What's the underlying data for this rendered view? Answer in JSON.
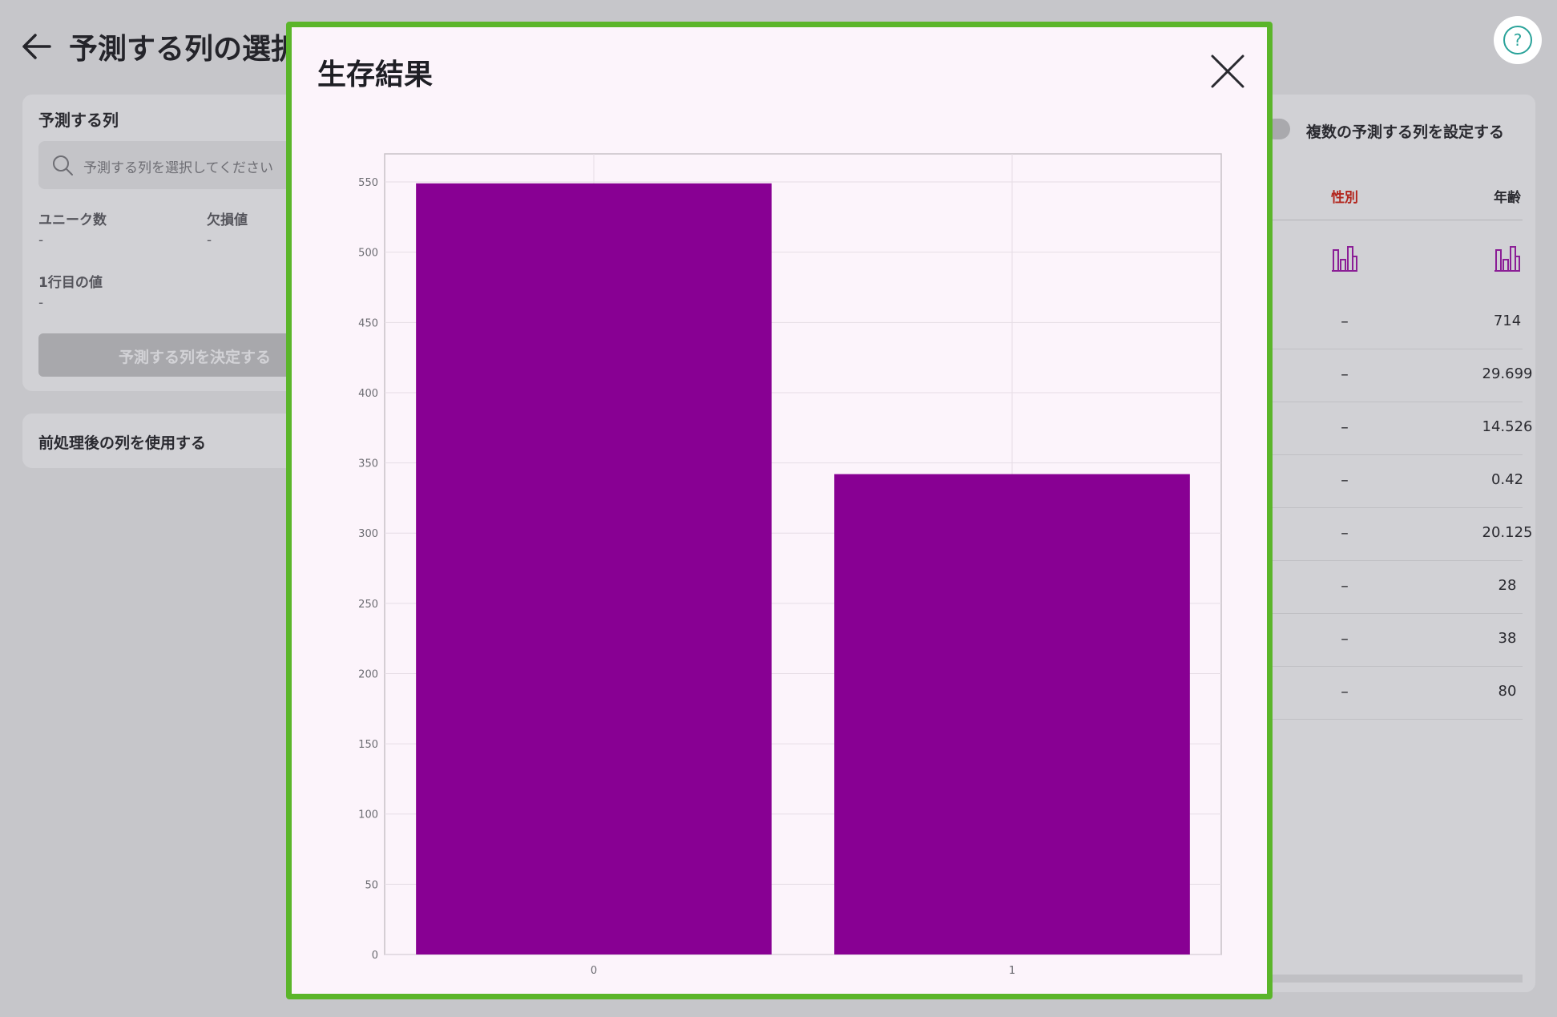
{
  "page": {
    "title": "予測する列の選択",
    "help_icon": "question-circle-icon"
  },
  "target_card": {
    "heading": "予測する列",
    "search_placeholder": "予測する列を選択してください",
    "unique_label": "ユニーク数",
    "unique_value": "-",
    "missing_label": "欠損値",
    "missing_value": "-",
    "first_row_label": "1行目の値",
    "first_row_value": "-",
    "decide_button": "予測する列を決定する"
  },
  "preprocess_card": {
    "label": "前処理後の列を使用する"
  },
  "right_panel": {
    "multi_toggle_label": "複数の予測する列を設定する",
    "columns": [
      "性別",
      "年齢"
    ],
    "rows": [
      {
        "sex": "–",
        "age": "714"
      },
      {
        "sex": "–",
        "age": "29.699"
      },
      {
        "sex": "–",
        "age": "14.526"
      },
      {
        "sex": "–",
        "age": "0.42"
      },
      {
        "sex": "–",
        "age": "20.125"
      },
      {
        "sex": "–",
        "age": "28"
      },
      {
        "sex": "–",
        "age": "38"
      },
      {
        "sex": "–",
        "age": "80"
      }
    ],
    "accent_color": "#b3261e",
    "hist_color": "#8b1e96"
  },
  "modal": {
    "title": "生存結果",
    "close_icon": "close-icon",
    "border_color": "#5bb52a"
  },
  "chart_data": {
    "type": "bar",
    "categories": [
      "0",
      "1"
    ],
    "values": [
      549,
      342
    ],
    "ylim": [
      0,
      570
    ],
    "yticks": [
      "0",
      "50",
      "100",
      "150",
      "200",
      "250",
      "300",
      "350",
      "400",
      "450",
      "500",
      "550"
    ],
    "bar_color": "#880093",
    "grid": true
  }
}
